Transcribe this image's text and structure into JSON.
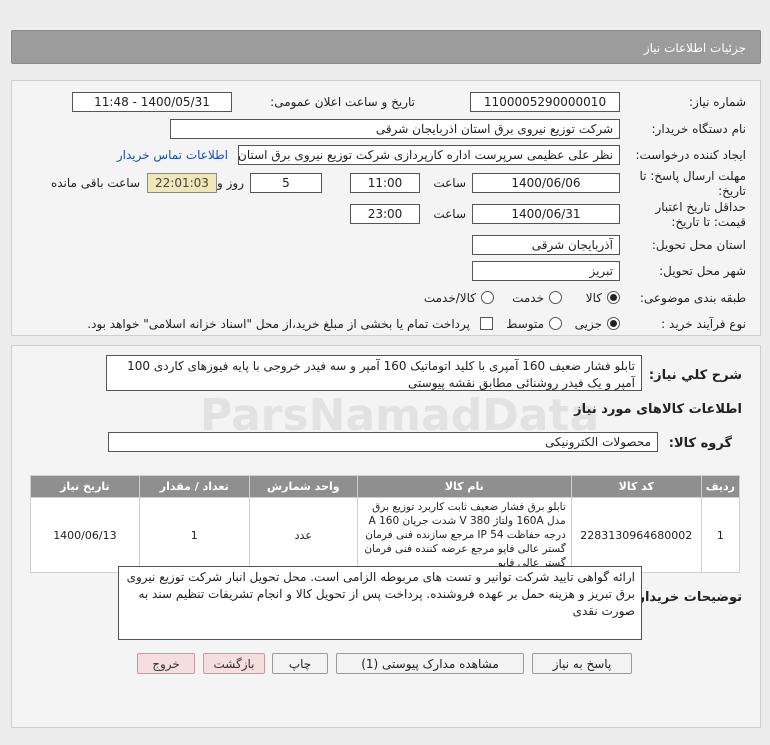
{
  "header": {
    "title": "جزئیات اطلاعات نیاز"
  },
  "form": {
    "need_number_label": "شماره نیاز:",
    "need_number": "1100005290000010",
    "announce_label": "تاریخ و ساعت اعلان عمومی:",
    "announce_value": "1400/05/31 - 11:48",
    "buyer_label": "نام دستگاه خریدار:",
    "buyer_value": "شرکت توزیع نیروی برق استان اذربایجان شرقی",
    "creator_label": "ایجاد کننده درخواست:",
    "creator_value": "نظر علی عظیمی سرپرست اداره کارپردازی شرکت توزیع نیروی برق استان اذربایجان",
    "contact_link": "اطلاعات تماس خریدار",
    "deadline_label_1": "مهلت ارسال پاسخ: تا",
    "deadline_label_2": "تاریخ:",
    "deadline_date": "1400/06/06",
    "time_label": "ساعت",
    "deadline_time": "11:00",
    "days_value": "5",
    "days_label": "روز و",
    "remaining_value": "22:01:03",
    "remaining_label": "ساعت باقی مانده",
    "validity_label_1": "حداقل تاریخ اعتبار",
    "validity_label_2": "قیمت: تا تاریخ:",
    "validity_date": "1400/06/31",
    "validity_time_label": "ساعت",
    "validity_time": "23:00",
    "province_label": "استان محل تحویل:",
    "province_value": "آذربایجان شرقی",
    "city_label": "شهر محل تحویل:",
    "city_value": "تبریز",
    "category_label": "طبقه بندی موضوعی:",
    "category_options": [
      "کالا",
      "خدمت",
      "کالا/خدمت"
    ],
    "category_selected": "کالا",
    "process_label": "نوع فرآیند خرید :",
    "process_options": [
      "جزیی",
      "متوسط"
    ],
    "process_selected": "جزیی",
    "payment_note": "پرداخت تمام یا بخشی از مبلغ خرید،از محل \"اسناد خزانه اسلامی\" خواهد بود."
  },
  "summary": {
    "label": "شرح کلي نیاز:",
    "text": "تابلو فشار ضعیف 160 آمپری با کلید اتوماتیک 160 آمپر و سه فیدر خروجی با پایه فیوزهای کاردی 100 آمپر و یک فیدر روشنائی مطابق نقشه پیوستی"
  },
  "goods": {
    "section_title": "اطلاعات کالاهای مورد نیاز",
    "group_label": "گروه کالا:",
    "group_value": "محصولات الکترونیکی",
    "columns": [
      "ردیف",
      "کد کالا",
      "نام کالا",
      "واحد شمارش",
      "تعداد / مقدار",
      "تاریخ نیاز"
    ],
    "rows": [
      {
        "row": "1",
        "code": "2283130964680002",
        "name": "تابلو برق فشار ضعیف ثابت کاربرد توزیع برق مدل 160A ولتاژ 380 V شدت جریان A 160 درجه حفاظت IP 54 مرجع سازنده فنی فرمان گستر عالی فاپو مرجع عرضه کننده فنی فرمان گستر عالی فاپو",
        "unit": "عدد",
        "qty": "1",
        "date": "1400/06/13"
      }
    ]
  },
  "buyer_notes": {
    "label": "توضیحات خریدار:",
    "text": "ارائه گواهی تایید شرکت توانیر و تست های مربوطه الزامی است. محل تحویل انبار شرکت توزیع نیروی برق تبریز و هزینه حمل بر عهده فروشنده. پرداخت پس از تحویل کالا و انجام تشریفات تنظیم سند به صورت نقدی"
  },
  "buttons": {
    "reply": "پاسخ به نیاز",
    "docs": "مشاهده مدارک پیوستی (1)",
    "print": "چاپ",
    "back": "بازگشت",
    "exit": "خروج"
  },
  "colors": {
    "header_bg": "#9c9c9c",
    "table_header_bg": "#8f8f8f",
    "remaining_bg": "#efe7b5",
    "link": "#1a4fb3"
  }
}
